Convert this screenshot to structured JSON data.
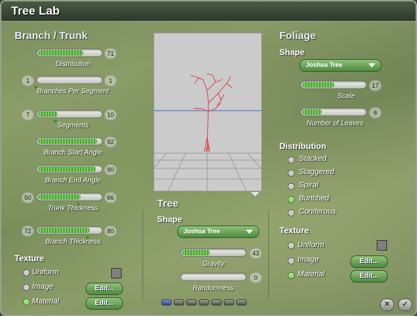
{
  "window": {
    "title": "Tree Lab"
  },
  "branch": {
    "heading": "Branch / Trunk",
    "sliders": [
      {
        "label": "Distribution",
        "left_value": null,
        "right_value": "71",
        "fill": 0.71
      },
      {
        "label": "Branches Per Segment",
        "left_value": "1",
        "right_value": "1",
        "fill": 0.0
      },
      {
        "label": "Segments",
        "left_value": "7",
        "right_value": "10",
        "fill": 0.3
      },
      {
        "label": "Branch Start Angle",
        "left_value": null,
        "right_value": "92",
        "fill": 0.92
      },
      {
        "label": "Branch End Angle",
        "left_value": null,
        "right_value": "90",
        "fill": 0.9
      },
      {
        "label": "Trunk Thickness",
        "left_value": "50",
        "right_value": "66",
        "fill": 0.66
      },
      {
        "label": "Branch Thickness",
        "left_value": "72",
        "right_value": "80",
        "fill": 0.8
      }
    ]
  },
  "texture_left": {
    "heading": "Texture",
    "options": [
      {
        "label": "Uniform",
        "selected": false
      },
      {
        "label": "Image",
        "selected": false
      },
      {
        "label": "Material",
        "selected": true
      }
    ],
    "edit_label": "Edit..."
  },
  "tree": {
    "heading": "Tree",
    "shape_label": "Shape",
    "shape_value": "Joshua Tree",
    "gravity": {
      "label": "Gravity",
      "value": "43",
      "fill": 0.43
    },
    "randomness": {
      "label": "Randomness",
      "value": "0",
      "fill": 0.0
    }
  },
  "foliage": {
    "heading": "Foliage",
    "shape_label": "Shape",
    "shape_value": "Joshua Tree",
    "scale": {
      "label": "Scale",
      "value": "17",
      "fill": 0.5
    },
    "leaves": {
      "label": "Number of Leaves",
      "value": "6",
      "fill": 0.3
    },
    "distribution_label": "Distribution",
    "distribution_options": [
      {
        "label": "Stacked",
        "selected": false
      },
      {
        "label": "Staggered",
        "selected": false
      },
      {
        "label": "Spiral",
        "selected": false
      },
      {
        "label": "Bunched",
        "selected": true
      },
      {
        "label": "Coniferous",
        "selected": false
      }
    ]
  },
  "texture_right": {
    "heading": "Texture",
    "options": [
      {
        "label": "Uniform",
        "selected": false
      },
      {
        "label": "Image",
        "selected": false
      },
      {
        "label": "Material",
        "selected": true
      }
    ],
    "edit_label": "Edit..."
  },
  "footer": {
    "cancel_glyph": "✕",
    "ok_glyph": "✓",
    "page_count": 7,
    "page_active": 0
  },
  "colors": {
    "accent": "#4fa23e",
    "button": "#5e9a4a",
    "horizon": "#3a68c8",
    "tree": "#e0303a"
  }
}
